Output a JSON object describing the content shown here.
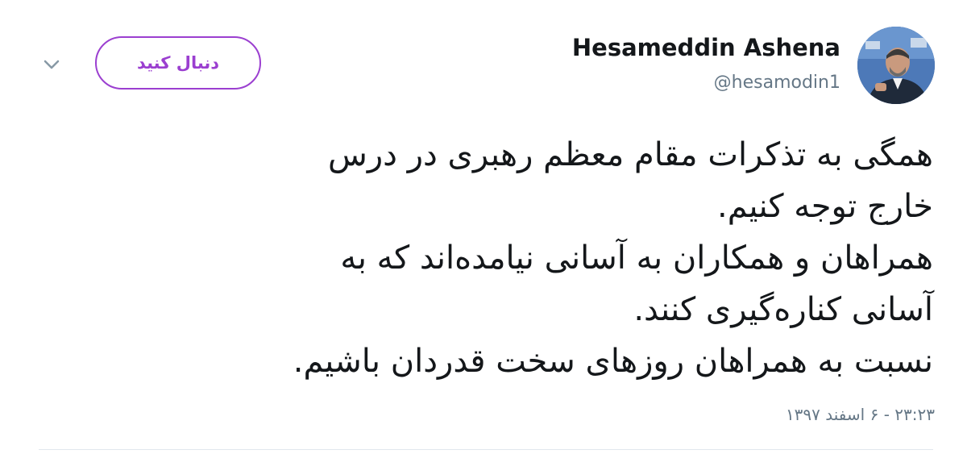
{
  "author": {
    "name": "Hesameddin Ashena",
    "handle": "@hesamodin1"
  },
  "follow_button": {
    "label": "دنبال کنید"
  },
  "menu": {
    "icon": "chevron-down-icon"
  },
  "tweet": {
    "lines": [
      "همگی به تذکرات مقام معظم رهبری در درس",
      "خارج توجه کنیم.",
      "همراهان و همکاران به آسانی نیامده‌اند که به",
      "آسانی کناره‌گیری کنند.",
      "نسبت به همراهان روزهای سخت قدردان باشیم."
    ],
    "timestamp": "۲۳:۲۳ - ۶ اسفند ۱۳۹۷"
  },
  "colors": {
    "accent": "#9b3fd0",
    "secondary_text": "#657786",
    "divider": "#e1e8ed"
  }
}
